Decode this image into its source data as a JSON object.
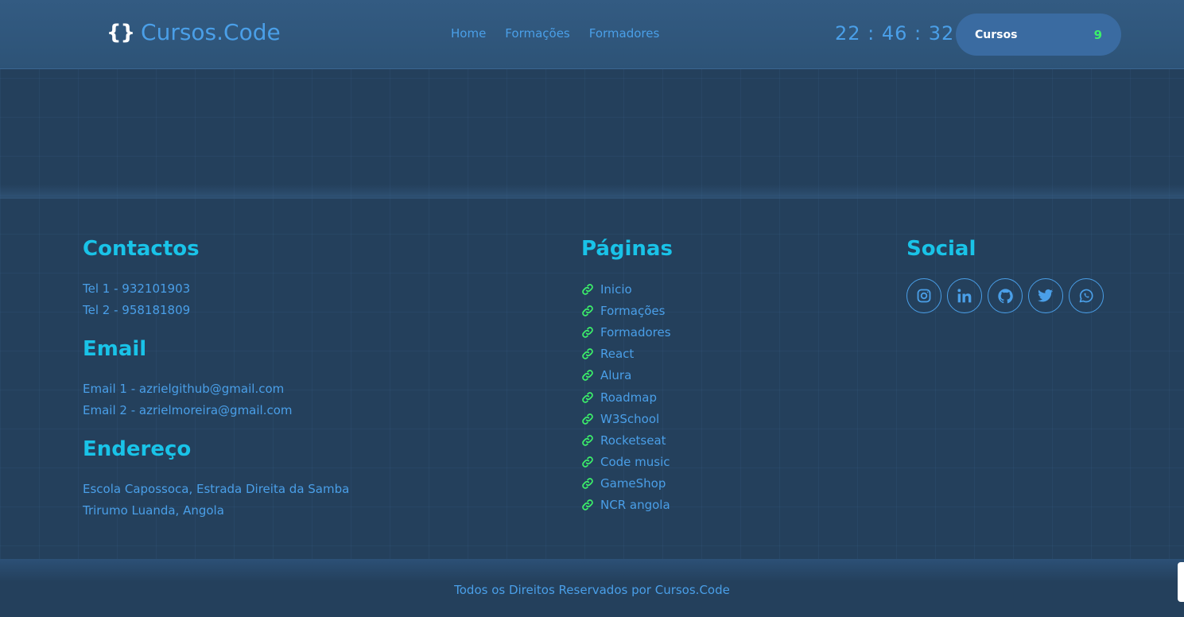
{
  "header": {
    "logo_brace": "{}",
    "logo_text": "Cursos.Code",
    "nav": [
      "Home",
      "Formações",
      "Formadores"
    ],
    "clock": "22 : 46 : 32",
    "cursos_label": "Cursos",
    "cursos_count": "9"
  },
  "contacts": {
    "title": "Contactos",
    "phones": [
      "Tel 1 - 932101903",
      "Tel 2 - 958181809"
    ],
    "email_title": "Email",
    "emails": [
      "Email 1 - azrielgithub@gmail.com",
      "Email 2 - azrielmoreira@gmail.com"
    ],
    "address_title": "Endereço",
    "address": [
      "Escola Capossoca, Estrada Direita da Samba",
      "Trirumo Luanda, Angola"
    ]
  },
  "pages": {
    "title": "Páginas",
    "links": [
      "Inicio",
      "Formações",
      "Formadores",
      "React",
      "Alura",
      "Roadmap",
      "W3School",
      "Rocketseat",
      "Code music",
      "GameShop",
      "NCR angola"
    ]
  },
  "social": {
    "title": "Social",
    "icons": [
      "instagram-icon",
      "linkedin-icon",
      "github-icon",
      "twitter-icon",
      "whatsapp-icon"
    ]
  },
  "footer": {
    "copyright": "Todos os Direitos Reservados por Cursos.Code"
  },
  "colors": {
    "accent": "#4a9fe8",
    "heading": "#19c3e8",
    "link_icon": "#3cf06a",
    "background": "#24405c"
  }
}
